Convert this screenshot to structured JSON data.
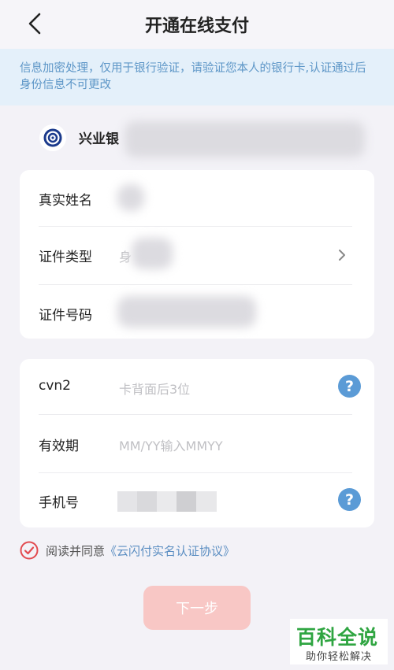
{
  "header": {
    "title": "开通在线支付",
    "back_icon": "chevron-left-icon"
  },
  "notice": {
    "text": "信息加密处理，仅用于银行验证，请验证您本人的银行卡,认证通过后身份信息不可更改"
  },
  "bank": {
    "name": "兴业银",
    "logo_icon": "bank-logo-icon"
  },
  "identity_card": {
    "rows": [
      {
        "label": "真实姓名",
        "value": ""
      },
      {
        "label": "证件类型",
        "value": "身"
      },
      {
        "label": "证件号码",
        "value": ""
      }
    ]
  },
  "card_info": {
    "rows": [
      {
        "label": "cvn2",
        "placeholder": "卡背面后3位"
      },
      {
        "label": "有效期",
        "placeholder": "MM/YY输入MMYY"
      },
      {
        "label": "手机号",
        "value": ""
      }
    ],
    "help_symbol": "?"
  },
  "agreement": {
    "prefix": "阅读并同意",
    "link": "《云闪付实名认证协议》",
    "checked": true
  },
  "next_button": {
    "label": "下一步"
  },
  "watermark": {
    "title": "百科全说",
    "subtitle": "助你轻松解决"
  },
  "colors": {
    "accent_red": "#e24a4f",
    "help_blue": "#5b9bd6",
    "link_blue": "#5b8ec2",
    "notice_bg": "#e4f0fa",
    "button_disabled": "#f8c7c5",
    "watermark_green": "#2fa541"
  }
}
